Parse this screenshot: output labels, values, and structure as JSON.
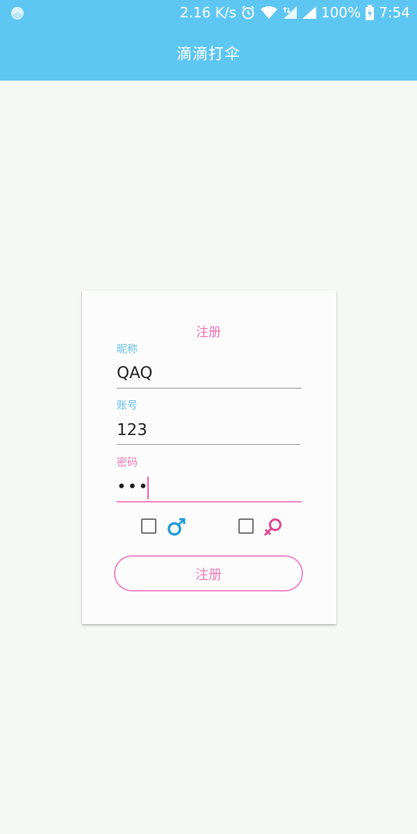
{
  "status_bar": {
    "speed": "2.16 K/s",
    "battery": "100%",
    "time": "7:54"
  },
  "app": {
    "title": "滴滴打伞"
  },
  "form": {
    "title": "注册",
    "nickname": {
      "label": "昵称",
      "value": "QAQ"
    },
    "account": {
      "label": "账号",
      "value": "123"
    },
    "password": {
      "label": "密码",
      "value": "•••"
    },
    "gender": {
      "male": {
        "checked": false,
        "icon": "male-symbol-icon",
        "color": "#1f98d6"
      },
      "female": {
        "checked": false,
        "icon": "female-symbol-icon",
        "color": "#e0418a"
      }
    },
    "submit_label": "注册"
  },
  "colors": {
    "app_bar": "#5ec6f2",
    "accent_pink": "#f06fb2",
    "label_blue": "#62bfe6"
  }
}
